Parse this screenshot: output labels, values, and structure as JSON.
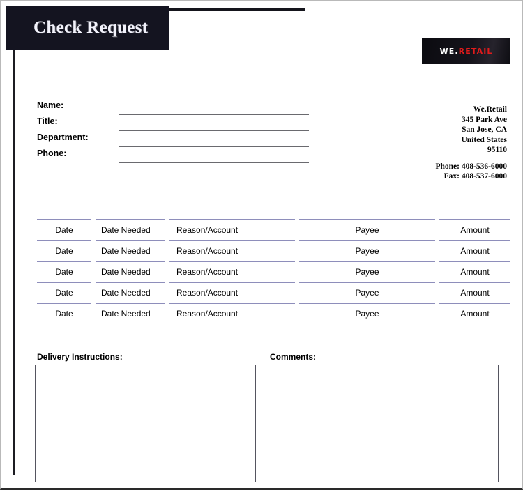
{
  "document": {
    "title": "Check Request"
  },
  "logo": {
    "primary": "WE.",
    "accent": "RETAIL",
    "primary_color": "#ffffff",
    "accent_color": "#e01b1b",
    "background_color": "#0d0d12"
  },
  "fields": [
    {
      "label": "Name:",
      "value": ""
    },
    {
      "label": "Title:",
      "value": ""
    },
    {
      "label": "Department:",
      "value": ""
    },
    {
      "label": "Phone:",
      "value": ""
    }
  ],
  "company": {
    "name": "We.Retail",
    "street": "345 Park Ave",
    "city_state": "San Jose, CA",
    "country": "United States",
    "zip": "95110",
    "phone": "Phone: 408-536-6000",
    "fax": "Fax: 408-537-6000"
  },
  "table": {
    "columns": [
      "Date",
      "Date Needed",
      "Reason/Account",
      "Payee",
      "Amount"
    ],
    "rows": [
      {
        "date": "Date",
        "date_needed": "Date Needed",
        "reason": "Reason/Account",
        "payee": "Payee",
        "amount": "Amount"
      },
      {
        "date": "Date",
        "date_needed": "Date Needed",
        "reason": "Reason/Account",
        "payee": "Payee",
        "amount": "Amount"
      },
      {
        "date": "Date",
        "date_needed": "Date Needed",
        "reason": "Reason/Account",
        "payee": "Payee",
        "amount": "Amount"
      },
      {
        "date": "Date",
        "date_needed": "Date Needed",
        "reason": "Reason/Account",
        "payee": "Payee",
        "amount": "Amount"
      },
      {
        "date": "Date",
        "date_needed": "Date Needed",
        "reason": "Reason/Account",
        "payee": "Payee",
        "amount": "Amount"
      }
    ]
  },
  "delivery": {
    "label": "Delivery Instructions:",
    "value": ""
  },
  "comments": {
    "label": "Comments:",
    "value": ""
  },
  "colors": {
    "header_background": "#141420",
    "table_rule": "#8e8ebb",
    "field_rule": "#6a6a6f",
    "box_border": "#555560"
  }
}
